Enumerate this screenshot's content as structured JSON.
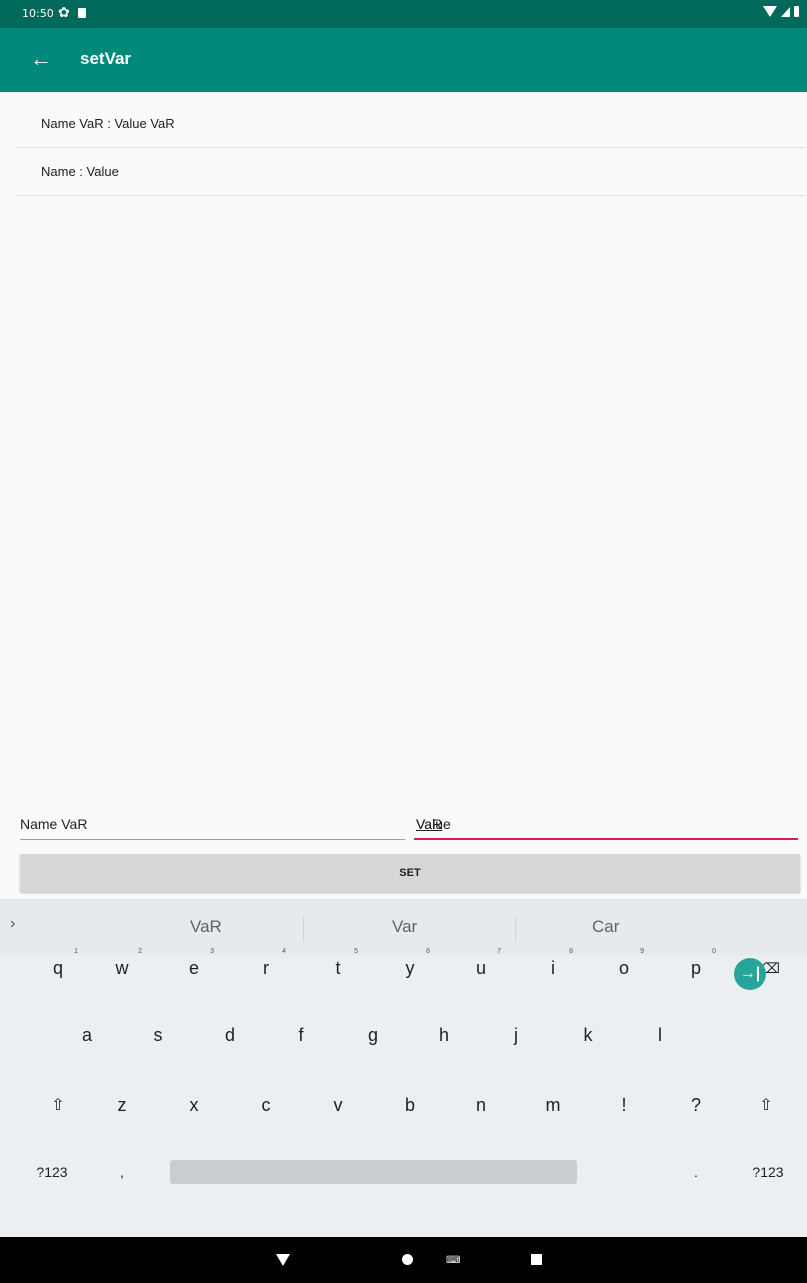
{
  "status_bar": {
    "time": "10:50",
    "icons": [
      "gear-icon",
      "sd-card-icon",
      "wifi-icon",
      "cell-signal-icon",
      "battery-icon"
    ]
  },
  "app_bar": {
    "title": "setVar",
    "back_icon": "arrow-back-icon",
    "color": "#00897b"
  },
  "list": {
    "items": [
      "Name VaR : Value VaR",
      "Name : Value"
    ]
  },
  "form": {
    "name_field_value": "Name VaR",
    "value_field_prefix": "Value ",
    "value_field_underlined": "VaR",
    "set_label": "SET"
  },
  "keyboard": {
    "suggestions": [
      "VaR",
      "Var",
      "Car"
    ],
    "row1": [
      {
        "key": "q",
        "hint": "1"
      },
      {
        "key": "w",
        "hint": "2"
      },
      {
        "key": "e",
        "hint": "3"
      },
      {
        "key": "r",
        "hint": "4"
      },
      {
        "key": "t",
        "hint": "5"
      },
      {
        "key": "y",
        "hint": "6"
      },
      {
        "key": "u",
        "hint": "7"
      },
      {
        "key": "i",
        "hint": "8"
      },
      {
        "key": "o",
        "hint": "9"
      },
      {
        "key": "p",
        "hint": "0"
      }
    ],
    "row2": [
      "a",
      "s",
      "d",
      "f",
      "g",
      "h",
      "j",
      "k",
      "l"
    ],
    "row3": [
      "z",
      "x",
      "c",
      "v",
      "b",
      "n",
      "m",
      "!",
      "?"
    ],
    "symbols_label": "?123",
    "comma": ",",
    "period": ".",
    "accent_color": "#26a69a"
  },
  "nav_bar": {
    "icons": [
      "back-triangle-icon",
      "home-circle-icon",
      "keyboard-icon",
      "recents-square-icon"
    ]
  }
}
